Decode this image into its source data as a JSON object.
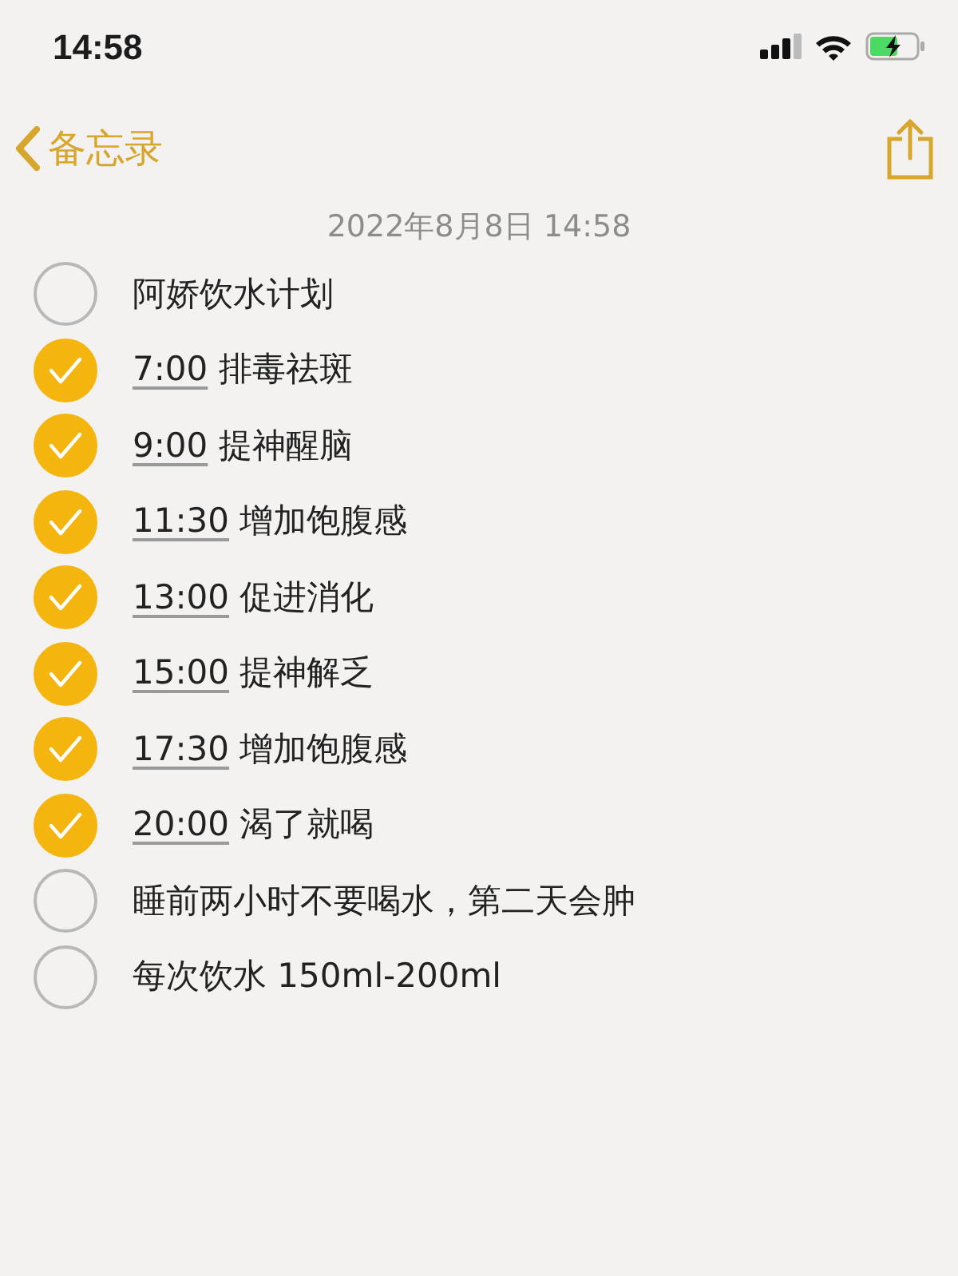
{
  "status_bar": {
    "time": "14:58"
  },
  "nav": {
    "back_label": "备忘录"
  },
  "note": {
    "date": "2022年8月8日 14:58",
    "checklist": [
      {
        "text": "阿娇饮水计划",
        "checked": false
      },
      {
        "time": "7:00",
        "text": " 排毒祛斑",
        "checked": true
      },
      {
        "time": "9:00",
        "text": " 提神醒脑",
        "checked": true
      },
      {
        "time": "11:30",
        "text": " 增加饱腹感",
        "checked": true
      },
      {
        "time": "13:00",
        "text": " 促进消化",
        "checked": true
      },
      {
        "time": "15:00",
        "text": " 提神解乏",
        "checked": true
      },
      {
        "time": "17:30",
        "text": " 增加饱腹感",
        "checked": true
      },
      {
        "time": "20:00",
        "text": " 渴了就喝",
        "checked": true
      },
      {
        "text": "睡前两小时不要喝水，第二天会肿",
        "checked": false
      },
      {
        "text": "每次饮水 150ml-200ml",
        "checked": false
      }
    ]
  }
}
